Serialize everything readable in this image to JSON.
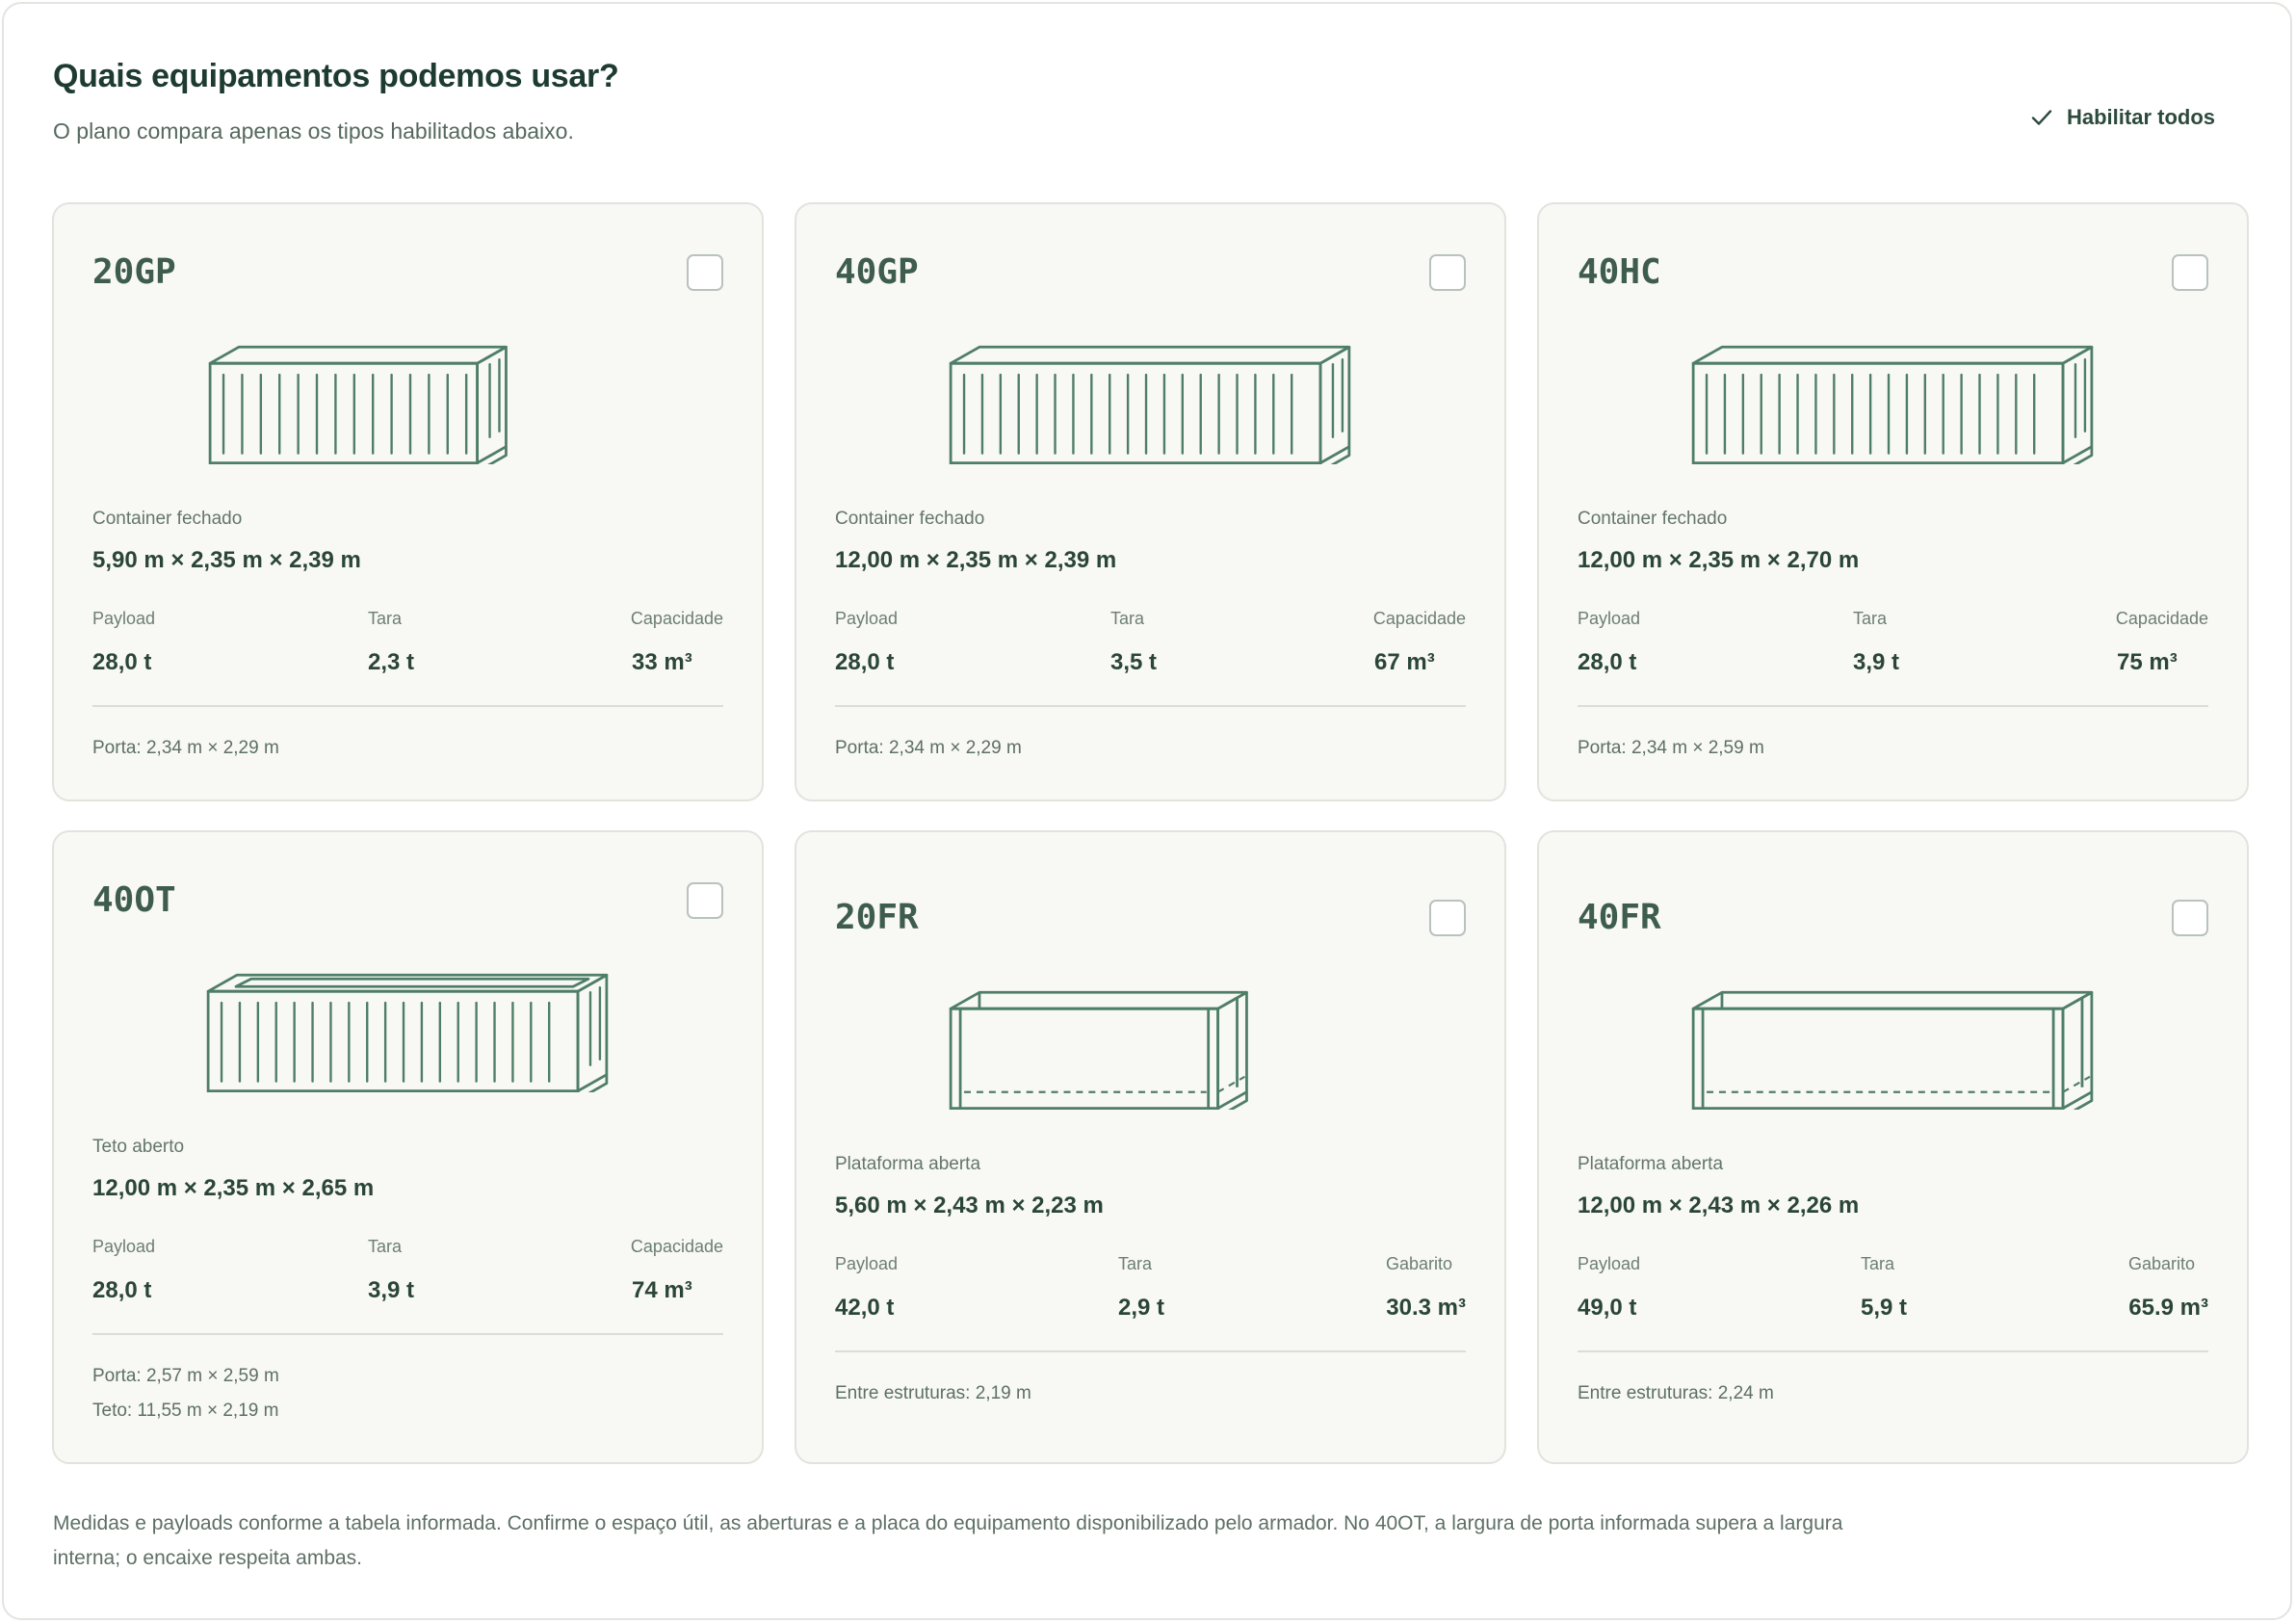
{
  "header": {
    "title": "Quais equipamentos podemos usar?",
    "subtitle": "O plano compara apenas os tipos habilitados abaixo.",
    "enable_all_label": "Habilitar todos"
  },
  "colors": {
    "accent": "#17705a",
    "card_enabled_bg": "#f1f6ef",
    "card_enabled_border": "#6a9e82",
    "card_disabled_bg": "#f8f8f5",
    "illustration_stroke": "#4f7e67"
  },
  "cards": [
    {
      "code": "20GP",
      "enabled": true,
      "kind": "Container fechado",
      "dims": "5,90 m × 2,35 m × 2,39 m",
      "stats": [
        {
          "label": "Payload",
          "value": "28,0 t"
        },
        {
          "label": "Tara",
          "value": "2,3 t"
        },
        {
          "label": "Capacidade",
          "value": "33 m³"
        }
      ],
      "notes": [
        "Porta: 2,34 m × 2,29 m"
      ],
      "icon": "closed-container-short-icon"
    },
    {
      "code": "40GP",
      "enabled": true,
      "kind": "Container fechado",
      "dims": "12,00 m × 2,35 m × 2,39 m",
      "stats": [
        {
          "label": "Payload",
          "value": "28,0 t"
        },
        {
          "label": "Tara",
          "value": "3,5 t"
        },
        {
          "label": "Capacidade",
          "value": "67 m³"
        }
      ],
      "notes": [
        "Porta: 2,34 m × 2,29 m"
      ],
      "icon": "closed-container-long-icon"
    },
    {
      "code": "40HC",
      "enabled": true,
      "kind": "Container fechado",
      "dims": "12,00 m × 2,35 m × 2,70 m",
      "stats": [
        {
          "label": "Payload",
          "value": "28,0 t"
        },
        {
          "label": "Tara",
          "value": "3,9 t"
        },
        {
          "label": "Capacidade",
          "value": "75 m³"
        }
      ],
      "notes": [
        "Porta: 2,34 m × 2,59 m"
      ],
      "icon": "closed-container-long-icon"
    },
    {
      "code": "40OT",
      "enabled": false,
      "kind": "Teto aberto",
      "dims": "12,00 m × 2,35 m × 2,65 m",
      "stats": [
        {
          "label": "Payload",
          "value": "28,0 t"
        },
        {
          "label": "Tara",
          "value": "3,9 t"
        },
        {
          "label": "Capacidade",
          "value": "74 m³"
        }
      ],
      "notes": [
        "Porta: 2,57 m × 2,59 m",
        "Teto: 11,55 m × 2,19 m"
      ],
      "icon": "open-top-container-icon"
    },
    {
      "code": "20FR",
      "enabled": false,
      "kind": "Plataforma aberta",
      "dims": "5,60 m × 2,43 m × 2,23 m",
      "stats": [
        {
          "label": "Payload",
          "value": "42,0 t"
        },
        {
          "label": "Tara",
          "value": "2,9 t"
        },
        {
          "label": "Gabarito",
          "value": "30.3 m³"
        }
      ],
      "notes": [
        "Entre estruturas: 2,19 m"
      ],
      "icon": "flat-rack-short-icon"
    },
    {
      "code": "40FR",
      "enabled": false,
      "kind": "Plataforma aberta",
      "dims": "12,00 m × 2,43 m × 2,26 m",
      "stats": [
        {
          "label": "Payload",
          "value": "49,0 t"
        },
        {
          "label": "Tara",
          "value": "5,9 t"
        },
        {
          "label": "Gabarito",
          "value": "65.9 m³"
        }
      ],
      "notes": [
        "Entre estruturas: 2,24 m"
      ],
      "icon": "flat-rack-long-icon"
    }
  ],
  "footer": {
    "text": "Medidas e payloads conforme a tabela informada. Confirme o espaço útil, as aberturas e a placa do equipamento disponibilizado pelo armador. No 40OT, a largura de porta informada supera a largura interna; o encaixe respeita ambas."
  }
}
